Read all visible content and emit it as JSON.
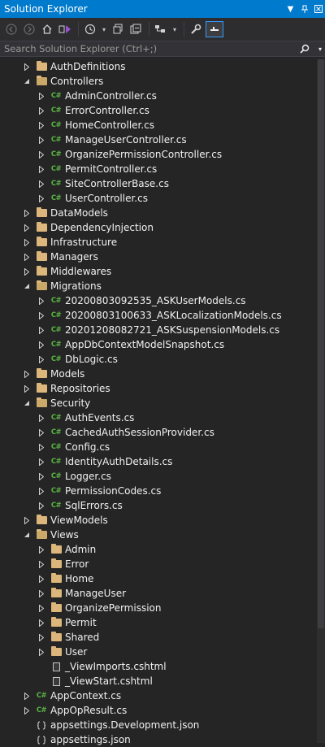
{
  "title": "Solution Explorer",
  "search_placeholder": "Search Solution Explorer (Ctrl+;)",
  "tree": [
    {
      "label": "AuthDefinitions",
      "icon": "folder",
      "expander": "collapsed",
      "indent": 1
    },
    {
      "label": "Controllers",
      "icon": "folder-open",
      "expander": "expanded",
      "indent": 1
    },
    {
      "label": "AdminController.cs",
      "icon": "csharp",
      "expander": "collapsed",
      "indent": 2
    },
    {
      "label": "ErrorController.cs",
      "icon": "csharp",
      "expander": "collapsed",
      "indent": 2
    },
    {
      "label": "HomeController.cs",
      "icon": "csharp",
      "expander": "collapsed",
      "indent": 2
    },
    {
      "label": "ManageUserController.cs",
      "icon": "csharp",
      "expander": "collapsed",
      "indent": 2
    },
    {
      "label": "OrganizePermissionController.cs",
      "icon": "csharp",
      "expander": "collapsed",
      "indent": 2
    },
    {
      "label": "PermitController.cs",
      "icon": "csharp",
      "expander": "collapsed",
      "indent": 2
    },
    {
      "label": "SiteControllerBase.cs",
      "icon": "csharp",
      "expander": "collapsed",
      "indent": 2
    },
    {
      "label": "UserController.cs",
      "icon": "csharp",
      "expander": "collapsed",
      "indent": 2
    },
    {
      "label": "DataModels",
      "icon": "folder",
      "expander": "collapsed",
      "indent": 1
    },
    {
      "label": "DependencyInjection",
      "icon": "folder",
      "expander": "collapsed",
      "indent": 1
    },
    {
      "label": "Infrastructure",
      "icon": "folder",
      "expander": "collapsed",
      "indent": 1
    },
    {
      "label": "Managers",
      "icon": "folder",
      "expander": "collapsed",
      "indent": 1
    },
    {
      "label": "Middlewares",
      "icon": "folder",
      "expander": "collapsed",
      "indent": 1
    },
    {
      "label": "Migrations",
      "icon": "folder-open",
      "expander": "expanded",
      "indent": 1
    },
    {
      "label": "20200803092535_ASKUserModels.cs",
      "icon": "csharp",
      "expander": "collapsed",
      "indent": 2
    },
    {
      "label": "20200803100633_ASKLocalizationModels.cs",
      "icon": "csharp",
      "expander": "collapsed",
      "indent": 2
    },
    {
      "label": "20201208082721_ASKSuspensionModels.cs",
      "icon": "csharp",
      "expander": "collapsed",
      "indent": 2
    },
    {
      "label": "AppDbContextModelSnapshot.cs",
      "icon": "csharp",
      "expander": "collapsed",
      "indent": 2
    },
    {
      "label": "DbLogic.cs",
      "icon": "csharp",
      "expander": "collapsed",
      "indent": 2
    },
    {
      "label": "Models",
      "icon": "folder",
      "expander": "collapsed",
      "indent": 1
    },
    {
      "label": "Repositories",
      "icon": "folder",
      "expander": "collapsed",
      "indent": 1
    },
    {
      "label": "Security",
      "icon": "folder-open",
      "expander": "expanded",
      "indent": 1
    },
    {
      "label": "AuthEvents.cs",
      "icon": "csharp",
      "expander": "collapsed",
      "indent": 2
    },
    {
      "label": "CachedAuthSessionProvider.cs",
      "icon": "csharp",
      "expander": "collapsed",
      "indent": 2
    },
    {
      "label": "Config.cs",
      "icon": "csharp",
      "expander": "collapsed",
      "indent": 2
    },
    {
      "label": "IdentityAuthDetails.cs",
      "icon": "csharp",
      "expander": "collapsed",
      "indent": 2
    },
    {
      "label": "Logger.cs",
      "icon": "csharp",
      "expander": "collapsed",
      "indent": 2
    },
    {
      "label": "PermissionCodes.cs",
      "icon": "csharp",
      "expander": "collapsed",
      "indent": 2
    },
    {
      "label": "SqlErrors.cs",
      "icon": "csharp",
      "expander": "collapsed",
      "indent": 2
    },
    {
      "label": "ViewModels",
      "icon": "folder",
      "expander": "collapsed",
      "indent": 1
    },
    {
      "label": "Views",
      "icon": "folder-open",
      "expander": "expanded",
      "indent": 1
    },
    {
      "label": "Admin",
      "icon": "folder",
      "expander": "collapsed",
      "indent": 2
    },
    {
      "label": "Error",
      "icon": "folder",
      "expander": "collapsed",
      "indent": 2
    },
    {
      "label": "Home",
      "icon": "folder",
      "expander": "collapsed",
      "indent": 2
    },
    {
      "label": "ManageUser",
      "icon": "folder",
      "expander": "collapsed",
      "indent": 2
    },
    {
      "label": "OrganizePermission",
      "icon": "folder",
      "expander": "collapsed",
      "indent": 2
    },
    {
      "label": "Permit",
      "icon": "folder",
      "expander": "collapsed",
      "indent": 2
    },
    {
      "label": "Shared",
      "icon": "folder",
      "expander": "collapsed",
      "indent": 2
    },
    {
      "label": "User",
      "icon": "folder",
      "expander": "collapsed",
      "indent": 2
    },
    {
      "label": "_ViewImports.cshtml",
      "icon": "page",
      "expander": "none",
      "indent": 2
    },
    {
      "label": "_ViewStart.cshtml",
      "icon": "page",
      "expander": "none",
      "indent": 2
    },
    {
      "label": "AppContext.cs",
      "icon": "csharp",
      "expander": "collapsed",
      "indent": 0
    },
    {
      "label": "AppOpResult.cs",
      "icon": "csharp",
      "expander": "collapsed",
      "indent": 0
    },
    {
      "label": "appsettings.Development.json",
      "icon": "json",
      "expander": "none",
      "indent": 0
    },
    {
      "label": "appsettings.json",
      "icon": "json",
      "expander": "none",
      "indent": 0
    }
  ]
}
